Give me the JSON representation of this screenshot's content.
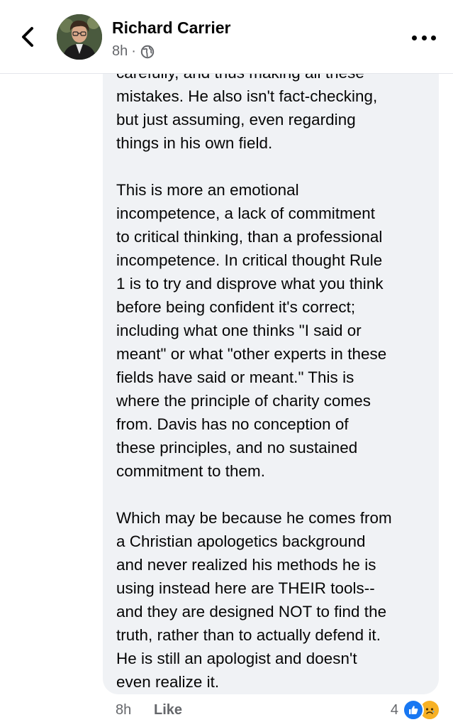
{
  "header": {
    "author_name": "Richard Carrier",
    "timestamp": "8h",
    "separator": "·",
    "privacy_icon": "globe-icon",
    "back_icon": "chevron-left-icon",
    "more_icon": "more-horizontal-icon"
  },
  "comment": {
    "cut_line": "carefully, and thus making all these",
    "paragraph_1_lines": [
      "mistakes. He also isn't fact-checking,",
      "but just assuming, even regarding",
      "things in his own field."
    ],
    "paragraph_2_lines": [
      "This is more an emotional",
      "incompetence, a lack of commitment",
      "to critical thinking, than a professional",
      "incompetence. In critical thought Rule",
      "1 is to try and disprove what you think",
      "before being confident it's correct;",
      "including what one thinks \"I said or",
      "meant\" or what \"other experts in these",
      "fields have said or meant.\" This is",
      "where the principle of charity comes",
      "from. Davis has no conception of",
      "these principles, and no sustained",
      "commitment to them."
    ],
    "paragraph_3_lines": [
      "Which may be because he comes from",
      "a Christian apologetics background",
      "and never realized his methods he is",
      "using instead here are THEIR tools--",
      "and they are designed NOT to find the",
      "truth, rather than to actually defend it.",
      "He is still an apologist and doesn't",
      "even realize it."
    ]
  },
  "footer": {
    "time": "8h",
    "like_label": "Like",
    "reaction_count": "4",
    "reaction_icons": [
      "like-reaction-icon",
      "sad-reaction-icon"
    ]
  },
  "colors": {
    "bubble_bg": "#f0f2f5",
    "text": "#050505",
    "secondary_text": "#65676b",
    "like_blue": "#1877f2",
    "sad_yellow": "#f7b125"
  }
}
